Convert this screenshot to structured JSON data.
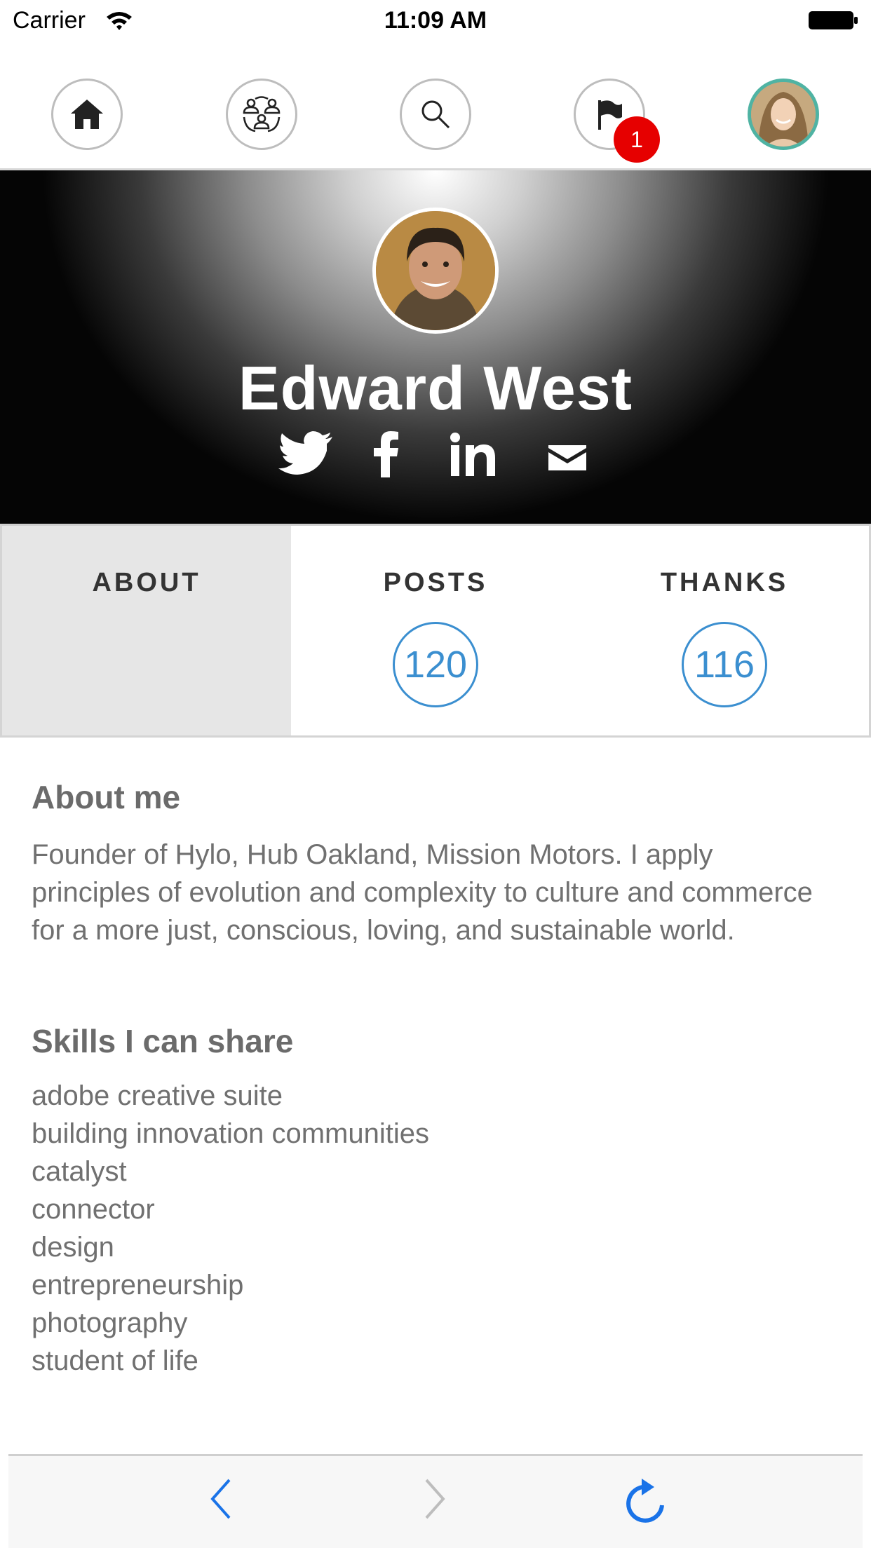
{
  "status_bar": {
    "carrier": "Carrier",
    "time": "11:09 AM"
  },
  "top_nav": {
    "items": [
      {
        "name": "home",
        "icon": "home-icon"
      },
      {
        "name": "community",
        "icon": "community-icon"
      },
      {
        "name": "search",
        "icon": "search-icon"
      },
      {
        "name": "notifications",
        "icon": "flag-icon",
        "badge": "1"
      },
      {
        "name": "my-profile",
        "icon": "avatar"
      }
    ],
    "badge_color": "#e60000",
    "avatar_ring_color": "#4fb3a3"
  },
  "profile": {
    "name": "Edward West",
    "social": [
      "twitter-icon",
      "facebook-icon",
      "linkedin-icon",
      "email-icon"
    ]
  },
  "tabs": [
    {
      "label": "ABOUT",
      "active": true
    },
    {
      "label": "POSTS",
      "count": "120"
    },
    {
      "label": "THANKS",
      "count": "116"
    }
  ],
  "accent_color": "#3b8fd0",
  "about": {
    "heading": "About me",
    "text": "Founder of Hylo, Hub Oakland, Mission Motors. I apply principles of evolution and complexity to culture and commerce for a more just, conscious, loving, and sustainable world."
  },
  "skills": {
    "heading": "Skills I can share",
    "items": [
      "adobe creative suite",
      "building innovation communities",
      "catalyst",
      "connector",
      "design",
      "entrepreneurship",
      "photography",
      "student of life"
    ]
  },
  "bottom_bar": {
    "buttons": [
      "back-icon",
      "forward-icon",
      "reload-icon"
    ]
  }
}
